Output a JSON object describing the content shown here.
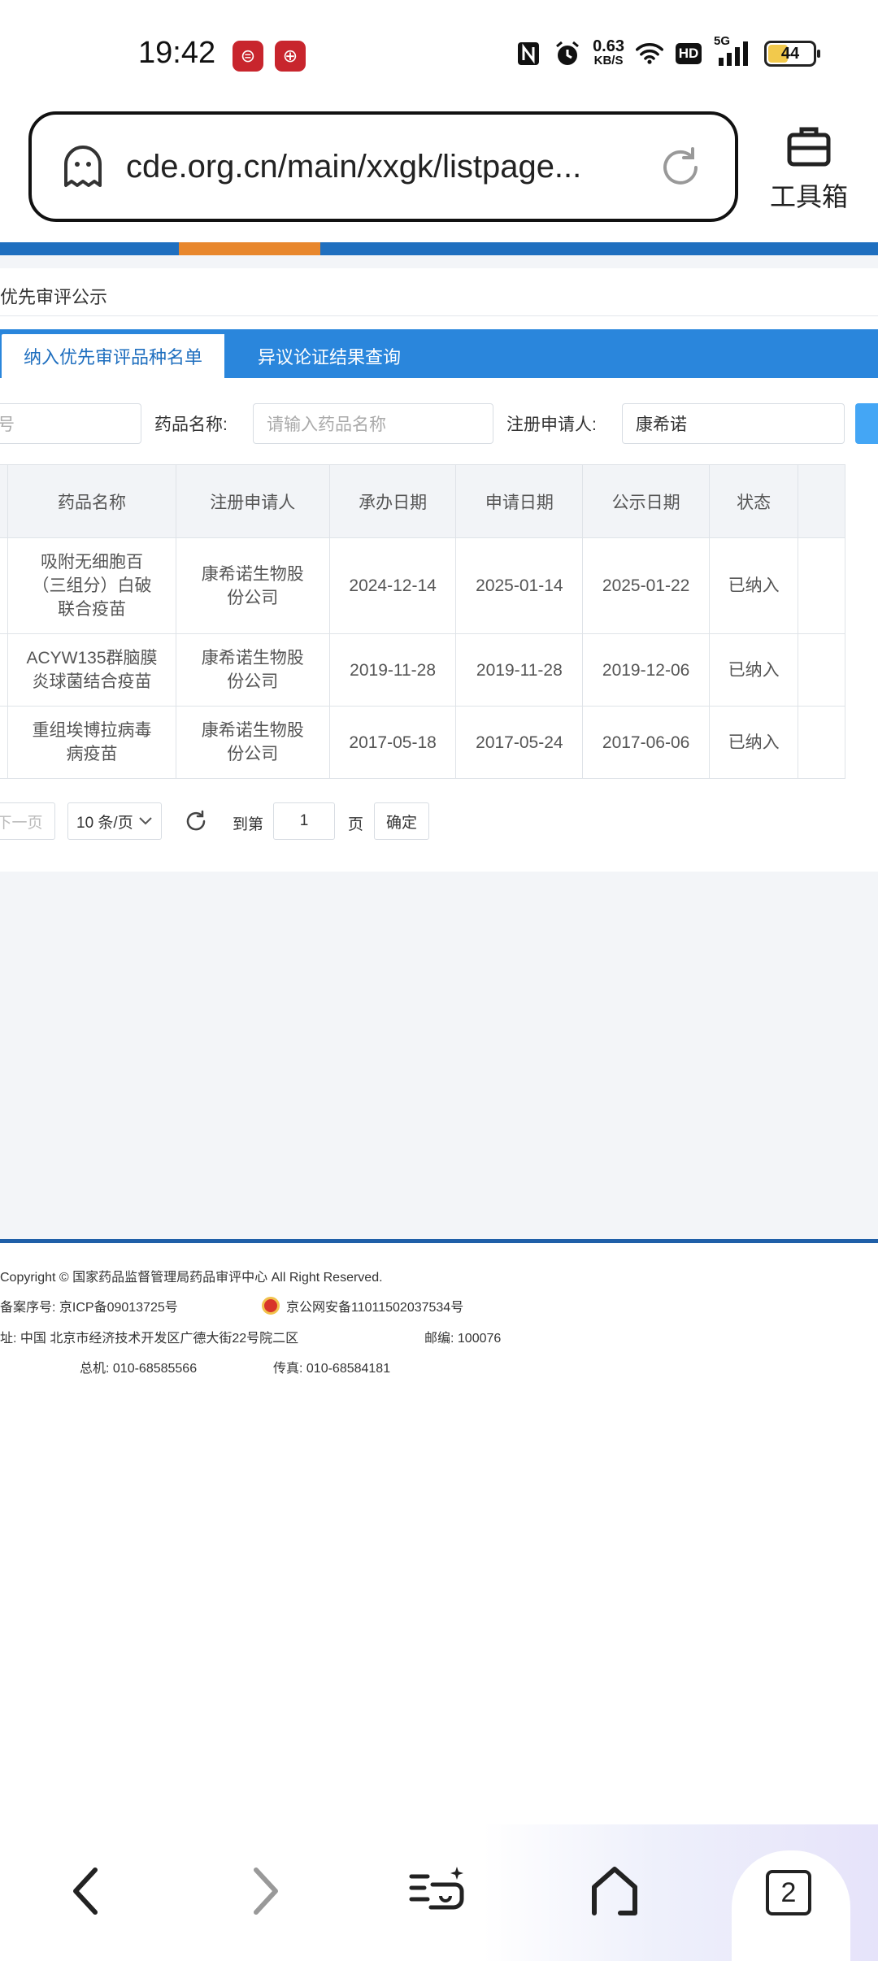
{
  "status_bar": {
    "time": "19:42",
    "app_icons": [
      "bank-app-icon",
      "boc-app-icon"
    ],
    "net_speed_value": "0.63",
    "net_speed_unit": "KB/S",
    "network_label": "5G",
    "hd_label": "HD",
    "battery": "44"
  },
  "browser": {
    "url": "cde.org.cn/main/xxgk/listpage...",
    "toolbox_label": "工具箱"
  },
  "site": {
    "breadcrumb": "优先审评公示",
    "tabs": [
      {
        "label": "纳入优先审评品种名单",
        "active": true
      },
      {
        "label": "异议论证结果查询",
        "active": false
      }
    ],
    "filters": {
      "first_field_tail": "号",
      "drug_name_label": "药品名称:",
      "drug_name_placeholder": "请输入药品名称",
      "applicant_label": "注册申请人:",
      "applicant_value": "康希诺"
    },
    "table": {
      "headers": [
        "药品名称",
        "注册申请人",
        "承办日期",
        "申请日期",
        "公示日期",
        "状态"
      ],
      "rows": [
        {
          "drug": "吸附无细胞百（三组分）白破联合疫苗",
          "applicant": "康希诺生物股份公司",
          "accept_date": "2024-12-14",
          "apply_date": "2025-01-14",
          "publish_date": "2025-01-22",
          "status": "已纳入"
        },
        {
          "drug": "ACYW135群脑膜炎球菌结合疫苗",
          "applicant": "康希诺生物股份公司",
          "accept_date": "2019-11-28",
          "apply_date": "2019-11-28",
          "publish_date": "2019-12-06",
          "status": "已纳入"
        },
        {
          "drug": "重组埃博拉病毒病疫苗",
          "applicant": "康希诺生物股份公司",
          "accept_date": "2017-05-18",
          "apply_date": "2017-05-24",
          "publish_date": "2017-06-06",
          "status": "已纳入"
        }
      ]
    },
    "pager": {
      "prev_label": "下一页",
      "page_size": "10 条/页",
      "goto_label": "到第",
      "page_value": "1",
      "page_unit": "页",
      "confirm_label": "确定"
    },
    "footer": {
      "copyright": "Copyright © 国家药品监督管理局药品审评中心   All Right Reserved.",
      "icp": "备案序号:  京ICP备09013725号",
      "police": "京公网安备11011502037534号",
      "address": "址:  中国 北京市经济技术开发区广德大街22号院二区",
      "postcode": "邮编:  100076",
      "phone": "总机:  010-68585566",
      "fax": "传真:  010-68584181"
    }
  },
  "bottom_nav": {
    "tab_count": "2"
  }
}
